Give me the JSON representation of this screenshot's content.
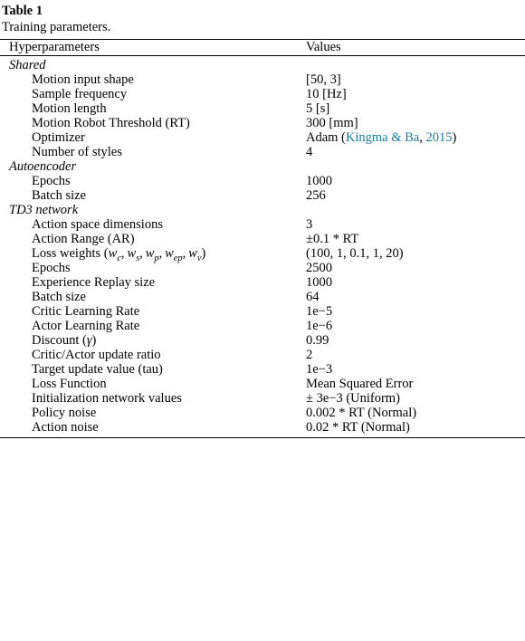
{
  "caption": {
    "label": "Table 1",
    "description": "Training parameters."
  },
  "columns": {
    "key": "Hyperparameters",
    "value": "Values"
  },
  "citation": {
    "authors": "Kingma & Ba",
    "year": "2015",
    "color": "#1a7ba4"
  },
  "sections": [
    {
      "name": "Shared",
      "rows": [
        {
          "key": "Motion input shape",
          "value": "[50, 3]"
        },
        {
          "key": "Sample frequency",
          "value": "10 [Hz]"
        },
        {
          "key": "Motion length",
          "value": "5 [s]"
        },
        {
          "key": "Motion Robot Threshold (RT)",
          "value": "300 [mm]"
        },
        {
          "key": "Optimizer",
          "value": "Adam (Kingma & Ba, 2015)"
        },
        {
          "key": "Number of styles",
          "value": "4"
        }
      ]
    },
    {
      "name": "Autoencoder",
      "rows": [
        {
          "key": "Epochs",
          "value": "1000"
        },
        {
          "key": "Batch size",
          "value": "256"
        }
      ]
    },
    {
      "name": "TD3 network",
      "rows": [
        {
          "key": "Action space dimensions",
          "value": "3"
        },
        {
          "key": "Action Range (AR)",
          "value": "±0.1 * RT"
        },
        {
          "key": "Loss weights (w_c, w_s, w_p, w_ep, w_v)",
          "value": "(100, 1, 0.1, 1, 20)"
        },
        {
          "key": "Epochs",
          "value": "2500"
        },
        {
          "key": "Experience Replay size",
          "value": "1000"
        },
        {
          "key": "Batch size",
          "value": "64"
        },
        {
          "key": "Critic Learning Rate",
          "value": "1e−5"
        },
        {
          "key": "Actor Learning Rate",
          "value": "1e−6"
        },
        {
          "key": "Discount (γ)",
          "value": "0.99"
        },
        {
          "key": "Critic/Actor update ratio",
          "value": "2"
        },
        {
          "key": "Target update value (tau)",
          "value": "1e−3"
        },
        {
          "key": "Loss Function",
          "value": "Mean Squared Error"
        },
        {
          "key": "Initialization network values",
          "value": "± 3e−3 (Uniform)"
        },
        {
          "key": "Policy noise",
          "value": "0.002 * RT (Normal)"
        },
        {
          "key": "Action noise",
          "value": "0.02 * RT (Normal)"
        }
      ]
    }
  ],
  "row_keys": {
    "loss_weights_prefix": "Loss weights (",
    "loss_weights_suffix": ")",
    "discount_prefix": "Discount (",
    "discount_suffix": ")",
    "optimizer_prefix": "Adam (",
    "optimizer_sep": ", ",
    "optimizer_suffix": ")"
  }
}
